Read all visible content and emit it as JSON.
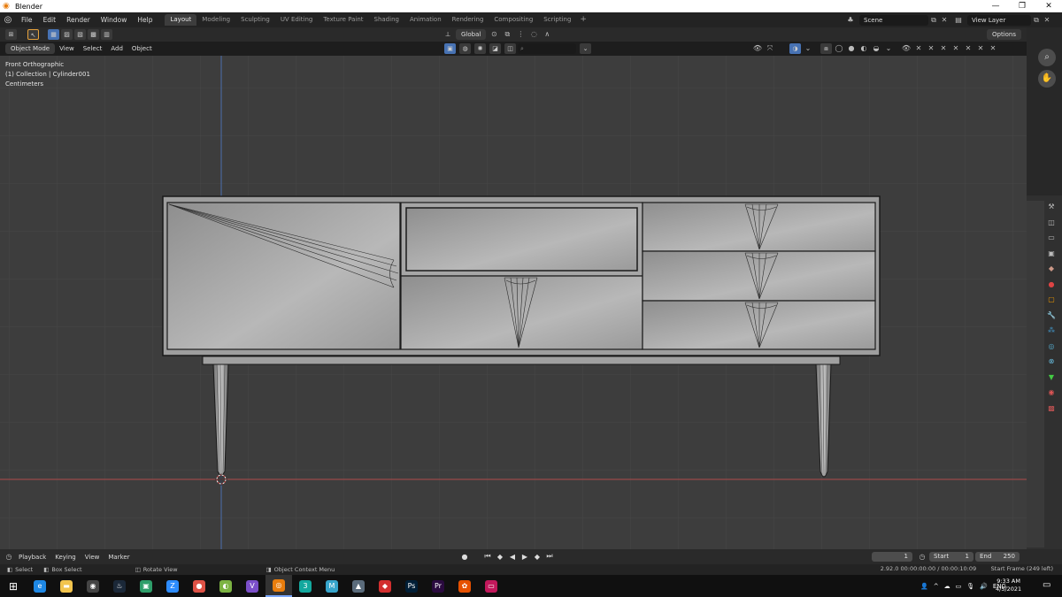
{
  "window": {
    "title": "Blender",
    "minimize": "—",
    "maximize": "❐",
    "close": "✕"
  },
  "menu": [
    "File",
    "Edit",
    "Render",
    "Window",
    "Help"
  ],
  "workspaces": [
    "Layout",
    "Modeling",
    "Sculpting",
    "UV Editing",
    "Texture Paint",
    "Shading",
    "Animation",
    "Rendering",
    "Compositing",
    "Scripting"
  ],
  "active_workspace": "Layout",
  "scene": {
    "label": "Scene",
    "view_layer": "View Layer"
  },
  "toolbar": {
    "orientation": "Global",
    "options": "Options"
  },
  "viewport_header": {
    "mode": "Object Mode",
    "menus": [
      "View",
      "Select",
      "Add",
      "Object"
    ]
  },
  "viewport_overlay": {
    "view_name": "Front Orthographic",
    "collection": "(1) Collection | Cylinder001",
    "units": "Centimeters"
  },
  "timeline": {
    "menus": [
      "Playback",
      "Keying",
      "View",
      "Marker"
    ],
    "current_frame": "1",
    "start_label": "Start",
    "start": "1",
    "end_label": "End",
    "end": "250"
  },
  "statusbar": {
    "select": "Select",
    "box_select": "Box Select",
    "rotate_view": "Rotate View",
    "context_menu": "Object Context Menu",
    "version_info": "2.92.0",
    "time_info": "00:00:00:00 / 00:00:10:09",
    "frame_info": "Start Frame (249 left)"
  },
  "taskbar": {
    "apps": [
      {
        "name": "edge",
        "glyph": "e",
        "color": "#1e88e5"
      },
      {
        "name": "file-explorer",
        "glyph": "▬",
        "color": "#f2c44d"
      },
      {
        "name": "obs",
        "glyph": "◉",
        "color": "#444444"
      },
      {
        "name": "steam",
        "glyph": "♨",
        "color": "#1b2838"
      },
      {
        "name": "app-green",
        "glyph": "▣",
        "color": "#2e9e6a"
      },
      {
        "name": "zoom",
        "glyph": "Z",
        "color": "#2d8cff"
      },
      {
        "name": "chrome",
        "glyph": "●",
        "color": "#de5246"
      },
      {
        "name": "app-lime",
        "glyph": "◐",
        "color": "#7cb342"
      },
      {
        "name": "visual-studio",
        "glyph": "V",
        "color": "#7b4fc9"
      },
      {
        "name": "blender",
        "glyph": "◎",
        "color": "#e87d0d"
      },
      {
        "name": "3ds-max",
        "glyph": "3",
        "color": "#13a89e"
      },
      {
        "name": "maya",
        "glyph": "M",
        "color": "#37a5cc"
      },
      {
        "name": "photos",
        "glyph": "▲",
        "color": "#5a6b7b"
      },
      {
        "name": "app-red",
        "glyph": "◆",
        "color": "#d32f2f"
      },
      {
        "name": "photoshop",
        "glyph": "Ps",
        "color": "#001e36"
      },
      {
        "name": "premiere",
        "glyph": "Pr",
        "color": "#2a0a3f"
      },
      {
        "name": "paint",
        "glyph": "✿",
        "color": "#e65100"
      },
      {
        "name": "app-pink",
        "glyph": "▭",
        "color": "#c2185b"
      }
    ],
    "language": "ENG",
    "time": "9:33 AM",
    "date": "4/5/2021"
  },
  "colors": {
    "accent": "#4772b3",
    "x_axis": "#b04a4a",
    "z_axis": "#4a6eb0"
  }
}
